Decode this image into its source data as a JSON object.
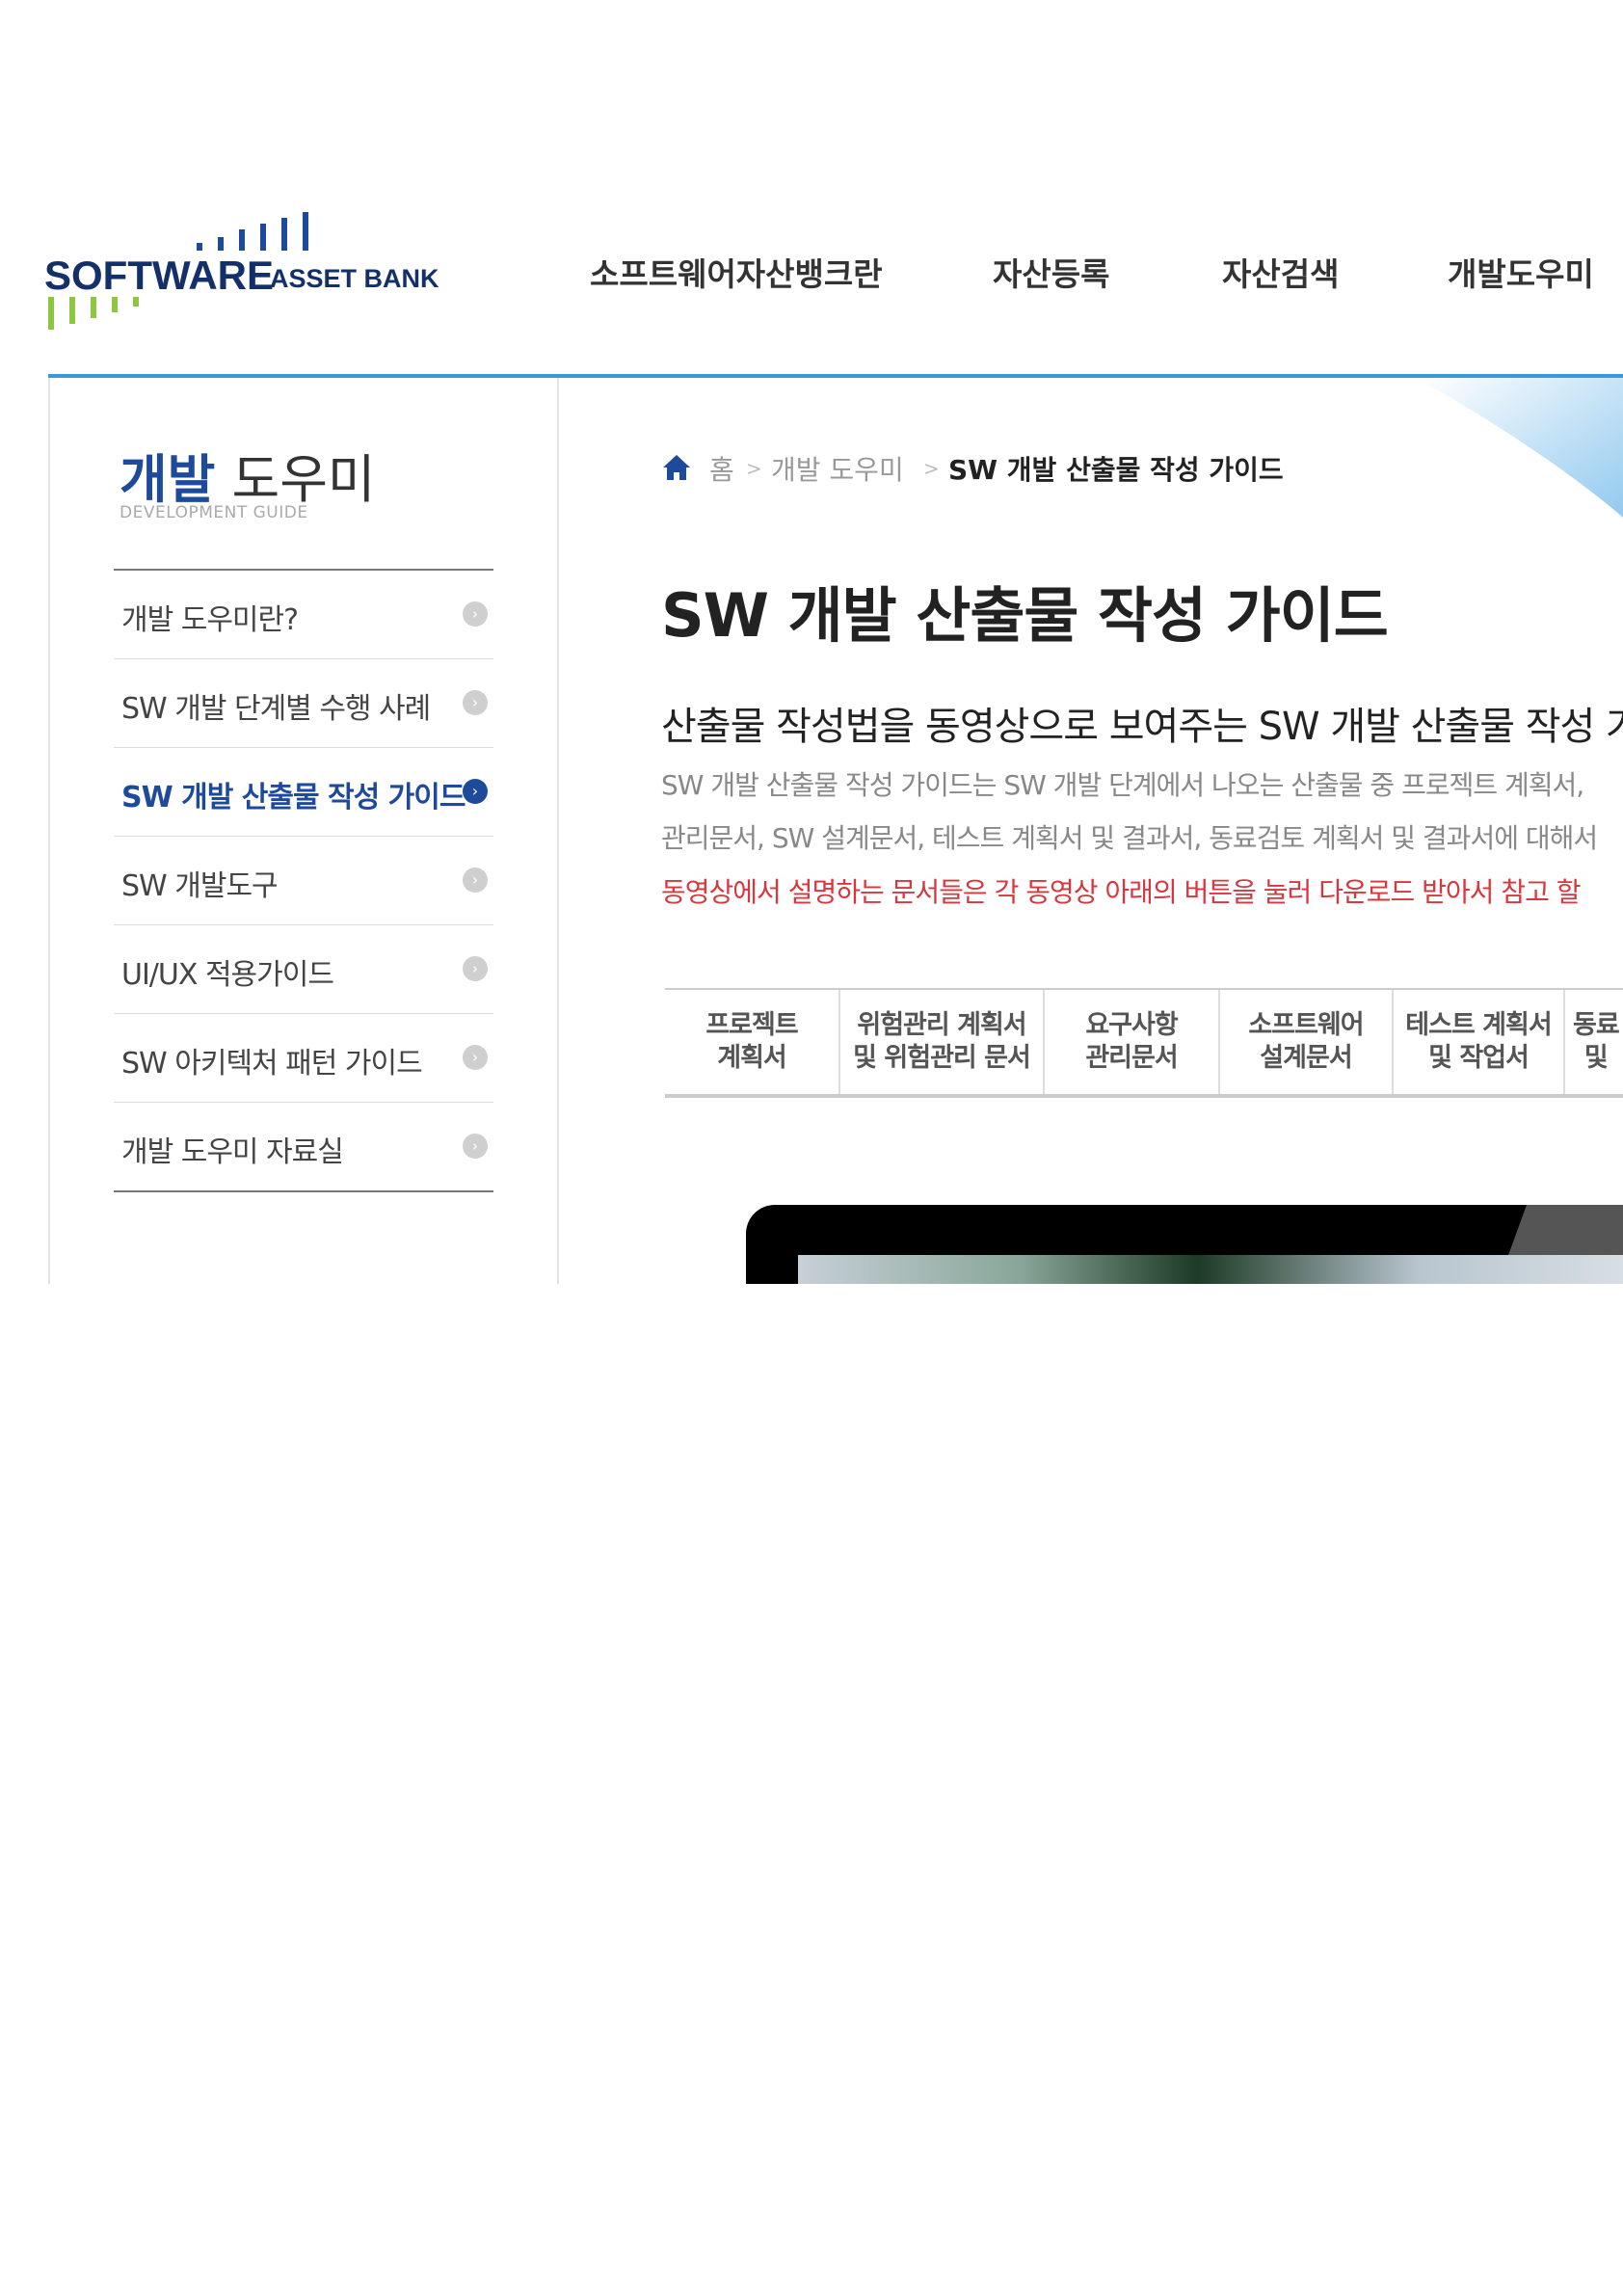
{
  "logo": {
    "wordmark": "SOFTWARE",
    "sub": "ASSET BANK"
  },
  "gnb": {
    "items": [
      {
        "label": "소프트웨어자산뱅크란"
      },
      {
        "label": "자산등록"
      },
      {
        "label": "자산검색"
      },
      {
        "label": "개발도우미"
      }
    ]
  },
  "lnb": {
    "title_strong": "개발",
    "title_rest": " 도우미",
    "subtitle": "DEVELOPMENT GUIDE",
    "items": [
      {
        "label": "개발 도우미란?"
      },
      {
        "label": "SW 개발 단계별 수행 사례"
      },
      {
        "label": "SW 개발 산출물 작성 가이드",
        "active": true
      },
      {
        "label": "SW 개발도구"
      },
      {
        "label": "UI/UX 적용가이드"
      },
      {
        "label": "SW 아키텍처 패턴 가이드"
      },
      {
        "label": "개발 도우미 자료실"
      }
    ]
  },
  "breadcrumb": {
    "home": "홈",
    "section": "개발 도우미",
    "current": "SW 개발 산출물 작성 가이드"
  },
  "content": {
    "title": "SW 개발 산출물 작성 가이드",
    "sub_heading": "산출물 작성법을 동영상으로 보여주는 SW 개발 산출물 작성 가이",
    "desc1": "SW 개발 산출물 작성 가이드는 SW 개발 단계에서 나오는 산출물 중 프로젝트 계획서,",
    "desc2": "관리문서, SW 설계문서, 테스트 계획서 및 결과서, 동료검토 계획서 및 결과서에 대해서",
    "desc3": "동영상에서 설명하는 문서들은 각 동영상 아래의 버튼을 눌러 다운로드 받아서 참고 할"
  },
  "tabs": [
    {
      "label": "프로젝트\n계획서"
    },
    {
      "label": "위험관리 계획서\n및 위험관리 문서"
    },
    {
      "label": "요구사항\n관리문서"
    },
    {
      "label": "소프트웨어\n설계문서"
    },
    {
      "label": "테스트 계획서\n및 작업서"
    },
    {
      "label": "동료\n및"
    }
  ],
  "colors": {
    "brand_navy": "#14306b",
    "accent_blue": "#3a9ad9",
    "active_nav": "#1e4a9c",
    "notice_red": "#d9363e"
  }
}
